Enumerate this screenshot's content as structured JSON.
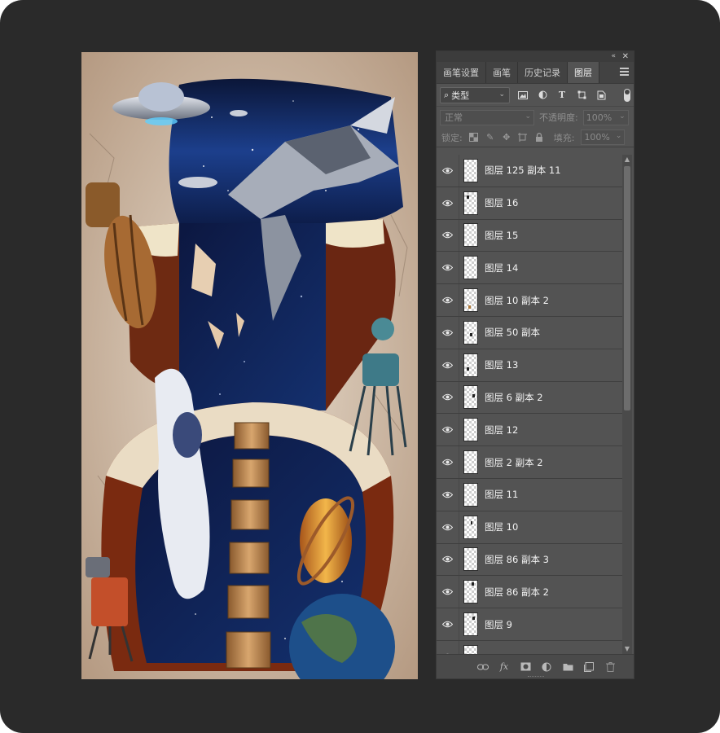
{
  "panel": {
    "collapse_glyph": "«",
    "close_glyph": "✕",
    "tabs": [
      {
        "label": "画笔设置",
        "active": false
      },
      {
        "label": "画笔",
        "active": false
      },
      {
        "label": "历史记录",
        "active": false
      },
      {
        "label": "图层",
        "active": true
      }
    ],
    "filter": {
      "search_glyph": "⌕",
      "value": "类型"
    },
    "filter_icons": [
      "image-filter-icon",
      "adjustment-filter-icon",
      "type-filter-icon",
      "shape-filter-icon",
      "smart-object-filter-icon"
    ],
    "blend_mode": "正常",
    "opacity_label": "不透明度:",
    "opacity_value": "100%",
    "lock_label": "锁定:",
    "fill_label": "填充:",
    "fill_value": "100%",
    "layers": [
      {
        "name": "图层 125 副本 11"
      },
      {
        "name": "图层 16"
      },
      {
        "name": "图层 15"
      },
      {
        "name": "图层 14"
      },
      {
        "name": "图层 10 副本 2"
      },
      {
        "name": "图层 50 副本"
      },
      {
        "name": "图层 13"
      },
      {
        "name": "图层 6 副本 2"
      },
      {
        "name": "图层 12"
      },
      {
        "name": "图层 2 副本 2"
      },
      {
        "name": "图层 11"
      },
      {
        "name": "图层 10"
      },
      {
        "name": "图层 86 副本 3"
      },
      {
        "name": "图层 86 副本 2"
      },
      {
        "name": "图层 9"
      },
      {
        "name": ""
      }
    ],
    "bottom_icons": [
      "link-layers-icon",
      "fx-icon",
      "add-mask-icon",
      "adjustment-layer-icon",
      "new-group-icon",
      "new-layer-icon",
      "delete-layer-icon"
    ]
  },
  "colors": {
    "app_bg": "#2a2a2a",
    "panel_bg": "#535353",
    "space_blue": "#12275e",
    "planet_orange": "#d98a2b"
  }
}
